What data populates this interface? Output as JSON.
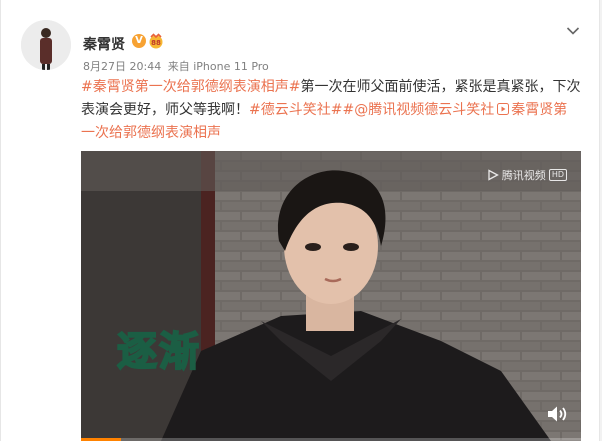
{
  "post": {
    "user": {
      "name": "秦霄贤",
      "verified_badge": "V"
    },
    "meta": {
      "date": "8月27日 20:44",
      "from_label": "来自",
      "device": "iPhone 11 Pro"
    },
    "text": {
      "hashtag1": "#秦霄贤第一次给郭德纲表演相声#",
      "body": "第一次在师父面前使活，紧张是真紧张，下次表演会更好，师父等我啊！",
      "hashtag2": "#德云斗笑社#",
      "mention": "#@腾讯视频德云斗笑社",
      "link_title": "秦霄贤第一次给郭德纲表演相声"
    },
    "video": {
      "watermark": "腾讯视频",
      "watermark_hd": "HD",
      "subtitle": "逐渐",
      "progress": 0.08
    }
  },
  "colors": {
    "link": "#eb7350",
    "subtitle_fill": "#57c9a0",
    "progress": "#ff8200"
  },
  "icons": [
    "chevron-down-icon",
    "verified-v-icon",
    "member-badge-icon",
    "video-link-icon",
    "volume-icon",
    "tencent-video-logo-icon"
  ]
}
